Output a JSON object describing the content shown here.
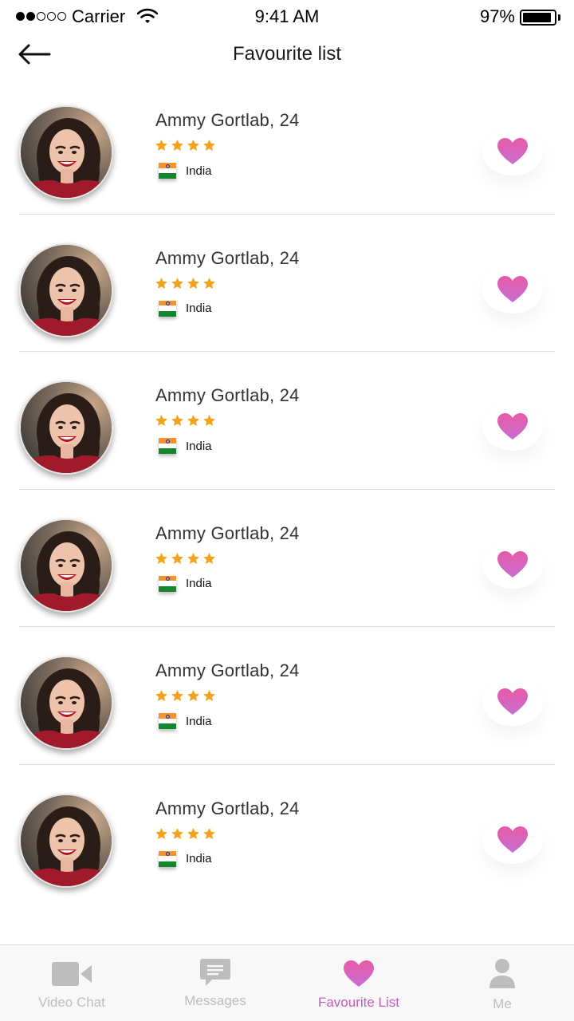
{
  "status_bar": {
    "carrier": "Carrier",
    "time": "9:41 AM",
    "battery": "97%",
    "signal_bars_filled": 2,
    "signal_bars_total": 5,
    "battery_level": 0.97
  },
  "header": {
    "title": "Favourite list",
    "back_icon": "arrow-left-icon"
  },
  "favourites": [
    {
      "name": "Ammy Gortlab, 24",
      "rating": 4,
      "country": "India",
      "favourited": true
    },
    {
      "name": "Ammy Gortlab, 24",
      "rating": 4,
      "country": "India",
      "favourited": true
    },
    {
      "name": "Ammy Gortlab, 24",
      "rating": 4,
      "country": "India",
      "favourited": true
    },
    {
      "name": "Ammy Gortlab, 24",
      "rating": 4,
      "country": "India",
      "favourited": true
    },
    {
      "name": "Ammy Gortlab, 24",
      "rating": 4,
      "country": "India",
      "favourited": true
    },
    {
      "name": "Ammy Gortlab, 24",
      "rating": 4,
      "country": "India",
      "favourited": true
    }
  ],
  "tabs": [
    {
      "label": "Video Chat",
      "icon": "video-camera-icon",
      "active": false
    },
    {
      "label": "Messages",
      "icon": "chat-bubble-icon",
      "active": false
    },
    {
      "label": "Favourite List",
      "icon": "heart-icon",
      "active": true
    },
    {
      "label": "Me",
      "icon": "user-icon",
      "active": false
    }
  ],
  "colors": {
    "accent_pink": "#c45bbd",
    "heart_gradient_top": "#e85aa6",
    "heart_gradient_bottom": "#c66ed2",
    "star": "#f5a21b",
    "inactive_tab": "#bdbdbd"
  }
}
